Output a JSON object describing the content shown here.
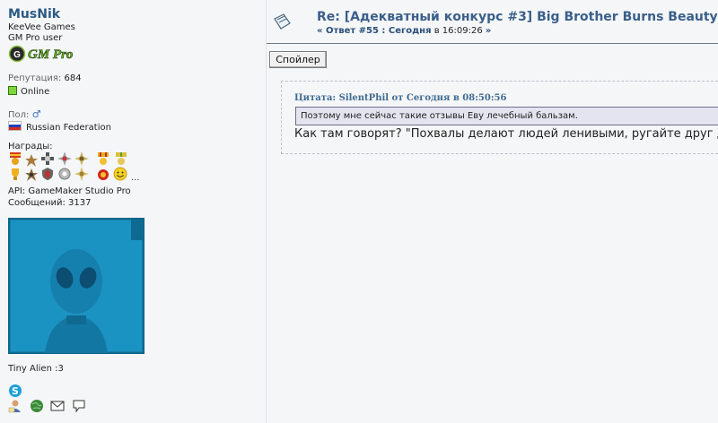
{
  "user": {
    "name": "MusNik",
    "team": "KeeVee Games",
    "group": "GM Pro user",
    "badge_text": "GM Pro",
    "reputation_label": "Репутация:",
    "reputation_value": "684",
    "status": "Online",
    "gender_label": "Пол:",
    "gender_symbol": "♂",
    "country": "Russian Federation",
    "awards_label": "Награды:",
    "awards_more": "...",
    "api": "API: GameMaker Studio Pro",
    "posts": "Сообщений: 3137",
    "caption": "Tiny Alien :3",
    "contact_icons": [
      "skype-icon",
      "profile-icon",
      "website-icon",
      "email-icon",
      "message-icon"
    ]
  },
  "post": {
    "title": "Re: [Адекватный конкурс #3] Big Brother Burns Beauty",
    "meta_prefix": "« Ответ #55 : Сегодня",
    "meta_mid": " в 16:09:26 ",
    "meta_suffix": "»",
    "spoiler_label": "Спойлер",
    "quote_header": "Цитата: SilentPhil от Сегодня в 08:50:56",
    "quote_text": "Поэтому мне сейчас такие отзывы Еву лечебный бальзам.",
    "body_text": "Как там говорят? \"Похвалы делают людей ленивыми, ругайте друг д"
  },
  "colors": {
    "username": "#2a5a85",
    "title": "#3a5f8a",
    "avatar_bg": "#1a8fbe",
    "quote_bg": "#e4e4f0"
  }
}
